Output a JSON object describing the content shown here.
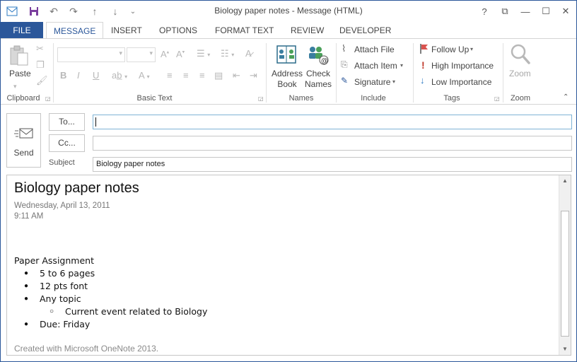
{
  "window": {
    "title": "Biology paper notes - Message (HTML)",
    "help_label": "?",
    "restore_ribbon_label": "⧉",
    "minimize_label": "—",
    "maximize_label": "☐",
    "close_label": "✕"
  },
  "qat": {
    "save": "💾",
    "undo": "↶",
    "redo": "↷",
    "up": "↑",
    "down": "↓",
    "customize": "⌄"
  },
  "tabs": [
    {
      "label": "FILE"
    },
    {
      "label": "MESSAGE"
    },
    {
      "label": "INSERT"
    },
    {
      "label": "OPTIONS"
    },
    {
      "label": "FORMAT TEXT"
    },
    {
      "label": "REVIEW"
    },
    {
      "label": "DEVELOPER"
    }
  ],
  "ribbon": {
    "clipboard": {
      "label": "Clipboard",
      "paste": "Paste"
    },
    "basic_text": {
      "label": "Basic Text"
    },
    "names": {
      "label": "Names",
      "address_book_1": "Address",
      "address_book_2": "Book",
      "check_names_1": "Check",
      "check_names_2": "Names"
    },
    "include": {
      "label": "Include",
      "attach_file": "Attach File",
      "attach_item": "Attach Item",
      "signature": "Signature"
    },
    "tags": {
      "label": "Tags",
      "follow_up": "Follow Up",
      "high_importance": "High Importance",
      "low_importance": "Low Importance"
    },
    "zoom": {
      "label": "Zoom",
      "zoom": "Zoom"
    }
  },
  "header": {
    "send": "Send",
    "to": "To...",
    "cc": "Cc...",
    "subject_label": "Subject",
    "to_value": "",
    "cc_value": "",
    "subject_value": "Biology paper notes"
  },
  "body": {
    "title": "Biology paper notes",
    "date": "Wednesday, April 13, 2011",
    "time": "9:11 AM",
    "heading": "Paper Assignment",
    "items": [
      "5 to 6 pages",
      "12 pts font",
      "Any topic"
    ],
    "subitem": "Current event related to Biology",
    "last_item": "Due: Friday",
    "footer": "Created with Microsoft OneNote 2013."
  },
  "colors": {
    "accent": "#2b579a",
    "follow_up_flag": "#d9534f",
    "high_importance": "#c0392b",
    "low_importance": "#2b79c2"
  }
}
